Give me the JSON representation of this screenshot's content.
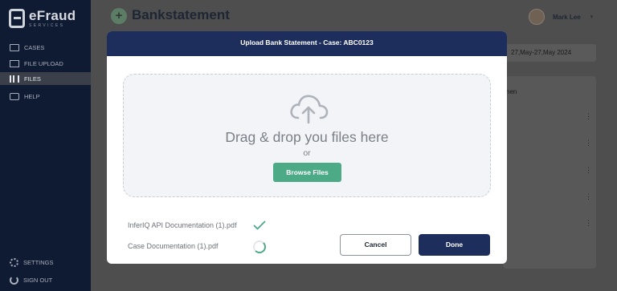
{
  "brand": {
    "name": "eFraud",
    "tagline": "SERVICES"
  },
  "sidebar": {
    "items": [
      {
        "label": "CASES",
        "icon": "briefcase-icon"
      },
      {
        "label": "FILE UPLOAD",
        "icon": "upload-icon"
      },
      {
        "label": "FILES",
        "icon": "files-icon",
        "active": true
      },
      {
        "label": "HELP",
        "icon": "help-icon"
      }
    ],
    "bottom": [
      {
        "label": "SETTINGS",
        "icon": "gear-icon"
      },
      {
        "label": "SIGN OUT",
        "icon": "sign-out-icon"
      }
    ]
  },
  "header": {
    "add_symbol": "+",
    "title": "Bankstatement",
    "user_name": "Mark Lee",
    "user_menu_symbol": "▾"
  },
  "background": {
    "date_range": "27,May-27,May 2024",
    "column_header": "nen",
    "row_menu_symbol": "⋮"
  },
  "modal": {
    "title": "Upload Bank Statement - Case: ABC0123",
    "dropzone": {
      "main_text": "Drag & drop you files here",
      "or_text": "or",
      "browse_label": "Browse Files"
    },
    "files": [
      {
        "name": "InferIQ  API Documentation (1).pdf",
        "status": "uploaded"
      },
      {
        "name": "Case Documentation (1).pdf",
        "status": "uploading"
      }
    ],
    "cancel_label": "Cancel",
    "done_label": "Done"
  },
  "colors": {
    "navy": "#1d2d5c",
    "green": "#4caa87",
    "sidebar": "#0f1a33"
  }
}
